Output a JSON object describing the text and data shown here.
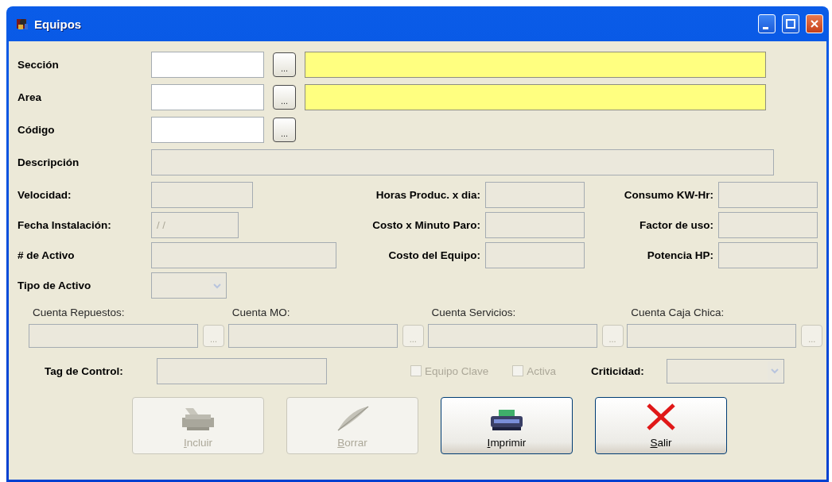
{
  "window": {
    "title": "Equipos"
  },
  "lookup_rows": [
    {
      "label": "Sección",
      "kind": "lookup_named",
      "button": "...",
      "disabled": false
    },
    {
      "label": "Area",
      "kind": "lookup_named",
      "button": "...",
      "disabled": false
    },
    {
      "label": "Código",
      "kind": "lookup",
      "button": "...",
      "disabled": false
    },
    {
      "label": "Descripción",
      "kind": "wide",
      "disabled": true
    }
  ],
  "details": [
    {
      "left": {
        "label": "Velocidad:",
        "kind": "short",
        "disabled": true
      },
      "middle": {
        "label": "Horas Produc. x dia:",
        "disabled": true
      },
      "right": {
        "label": "Consumo KW-Hr:",
        "disabled": true
      }
    },
    {
      "left": {
        "label": "Fecha Instalación:",
        "kind": "date",
        "value": "/ /",
        "disabled": true
      },
      "middle": {
        "label": "Costo x Minuto Paro:",
        "disabled": true
      },
      "right": {
        "label": "Factor de uso:",
        "disabled": true
      }
    },
    {
      "left": {
        "label": "# de Activo",
        "kind": "long",
        "disabled": true
      },
      "middle": {
        "label": "Costo del Equipo:",
        "disabled": true
      },
      "right": {
        "label": "Potencia HP:",
        "disabled": true
      }
    },
    {
      "left": {
        "label": "Tipo de Activo",
        "kind": "combo",
        "disabled": true
      }
    }
  ],
  "accounts": [
    {
      "label": "Cuenta Repuestos:",
      "button": "...",
      "disabled": true
    },
    {
      "label": "Cuenta MO:",
      "button": "...",
      "disabled": true
    },
    {
      "label": "Cuenta Servicios:",
      "button": "...",
      "disabled": true
    },
    {
      "label": "Cuenta Caja Chica:",
      "button": "...",
      "disabled": true
    }
  ],
  "tag_control": {
    "label": "Tag de Control:",
    "disabled": true
  },
  "checkboxes": [
    {
      "label": "Equipo Clave",
      "checked": false,
      "disabled": true
    },
    {
      "label": "Activa",
      "checked": false,
      "disabled": true
    }
  ],
  "criticidad": {
    "label": "Criticidad:",
    "disabled": true
  },
  "actions": [
    {
      "label": "Incluir",
      "kind": "add",
      "disabled": true
    },
    {
      "label": "Borrar",
      "kind": "delete",
      "disabled": true
    },
    {
      "label": "Imprimir",
      "kind": "print",
      "disabled": false
    },
    {
      "label": "Salir",
      "kind": "exit",
      "disabled": false
    }
  ]
}
